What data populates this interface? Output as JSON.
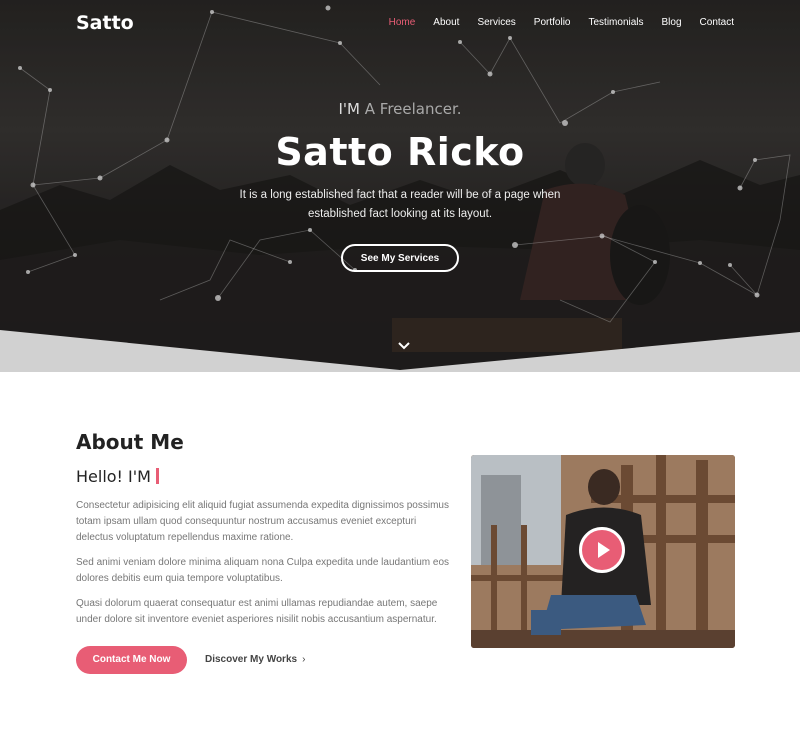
{
  "brand": "Satto",
  "nav": {
    "items": [
      "Home",
      "About",
      "Services",
      "Portfolio",
      "Testimonials",
      "Blog",
      "Contact"
    ],
    "active": "Home"
  },
  "hero": {
    "tagline_prefix": "I'M",
    "tagline_role": "A Freelancer.",
    "name": "Satto Ricko",
    "subtitle": "It is a long established fact that a reader will be of a page when established fact looking at its layout.",
    "cta": "See My Services"
  },
  "about": {
    "heading": "About Me",
    "hello": "Hello! I'M",
    "paragraphs": [
      "Consectetur adipisicing elit aliquid fugiat assumenda expedita dignissimos possimus totam ipsam ullam quod consequuntur nostrum accusamus eveniet excepturi delectus voluptatum repellendus maxime ratione.",
      "Sed animi veniam dolore minima aliquam nona Culpa expedita unde laudantium eos dolores debitis eum quia tempore voluptatibus.",
      "Quasi dolorum quaerat consequatur est animi ullamas repudiandae autem, saepe under dolore sit inventore eveniet asperiores nisilit nobis accusantium aspernatur."
    ],
    "contact_button": "Contact Me Now",
    "discover_link": "Discover My Works"
  },
  "icons": {
    "scroll": "chevron-down-icon",
    "play": "play-icon",
    "arrow": "chevron-right-icon"
  },
  "colors": {
    "accent": "#e85d75",
    "hero_bg": "#2a2826",
    "text_muted": "#777777"
  }
}
